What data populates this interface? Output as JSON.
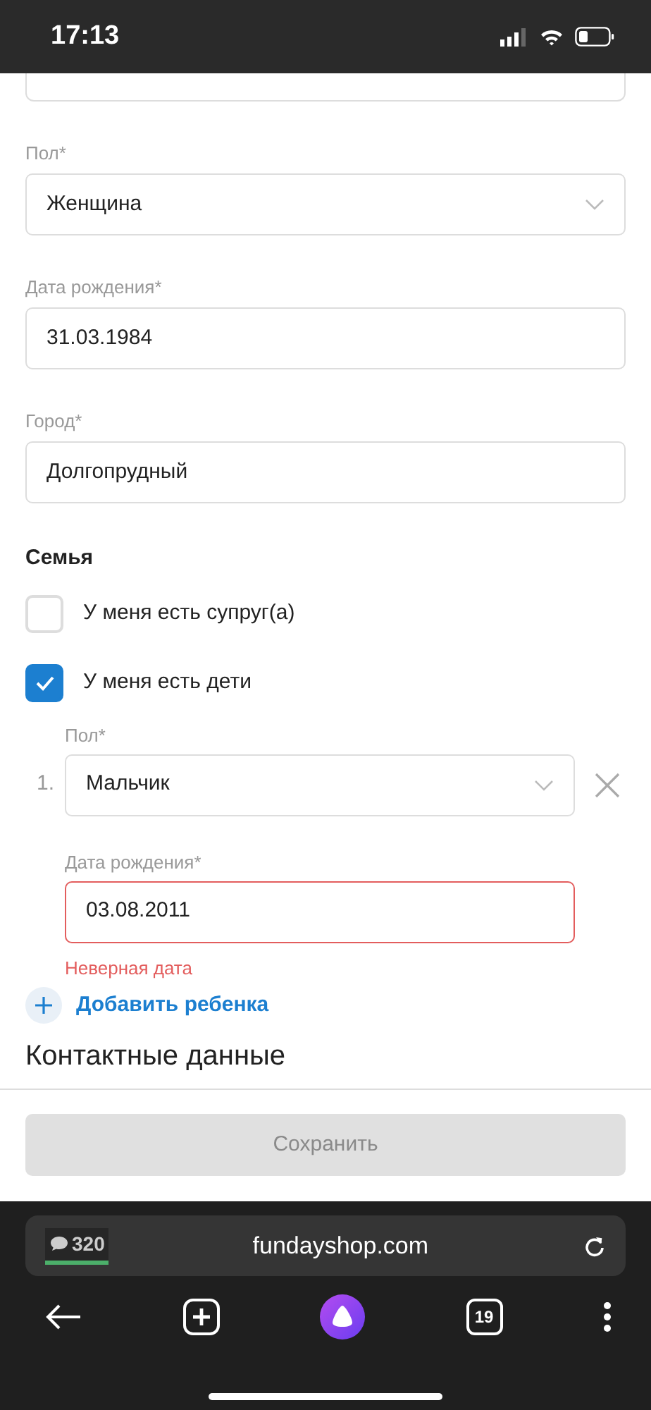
{
  "status_bar": {
    "time": "17:13"
  },
  "fields": [
    {
      "label": "Пол*",
      "value": "Женщина",
      "kind": "select"
    },
    {
      "label": "Дата рождения*",
      "value": "31.03.1984",
      "kind": "text"
    },
    {
      "label": "Город*",
      "value": "Долгопрудный",
      "kind": "text"
    }
  ],
  "family": {
    "title": "Семья",
    "checkboxes": [
      {
        "label": "У меня есть супруг(а)",
        "checked": false
      },
      {
        "label": "У меня есть дети",
        "checked": true
      }
    ],
    "children": [
      {
        "number": "1.",
        "gender": {
          "label": "Пол*",
          "value": "Мальчик"
        },
        "birth_date": {
          "label": "Дата рождения*",
          "value": "03.08.2011",
          "error": "Неверная дата"
        }
      }
    ],
    "add_button": "Добавить ребенка"
  },
  "next_section": "Контактные данные",
  "save_button": {
    "label": "Сохранить",
    "disabled": true
  },
  "browser": {
    "counter": "320",
    "url": "fundayshop.com",
    "tabs_count": "19"
  }
}
